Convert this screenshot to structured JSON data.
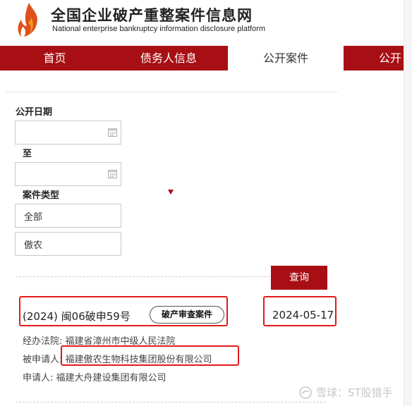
{
  "header": {
    "title": "全国企业破产重整案件信息网",
    "subtitle": "National enterprise bankruptcy  information disclosure platform"
  },
  "nav": {
    "tabs": [
      {
        "label": "首页"
      },
      {
        "label": "债务人信息"
      },
      {
        "label": "公开案件"
      },
      {
        "label": "公开"
      }
    ]
  },
  "filters": {
    "date_label": "公开日期",
    "date_to_label": "至",
    "date_from_value": "",
    "date_to_value": "",
    "case_type_label": "案件类型",
    "case_type_value": "全部",
    "keyword_value": "傲农",
    "query_label": "查询"
  },
  "case": {
    "number": "(2024)  闽06破申59号",
    "tag": "破产审查案件",
    "date": "2024-05-17",
    "court_label": "经办法院:",
    "court_value": "福建省漳州市中级人民法院",
    "respondent_label": "被申请人:",
    "respondent_value": "福建傲农生物科技集团股份有限公司",
    "applicant_label": "申请人:",
    "applicant_value": "福建大舟建设集团有限公司"
  },
  "watermark": "雪球：ST股猎手",
  "colors": {
    "brand_red": "#a80f14",
    "highlight_red": "#e01b1b"
  }
}
